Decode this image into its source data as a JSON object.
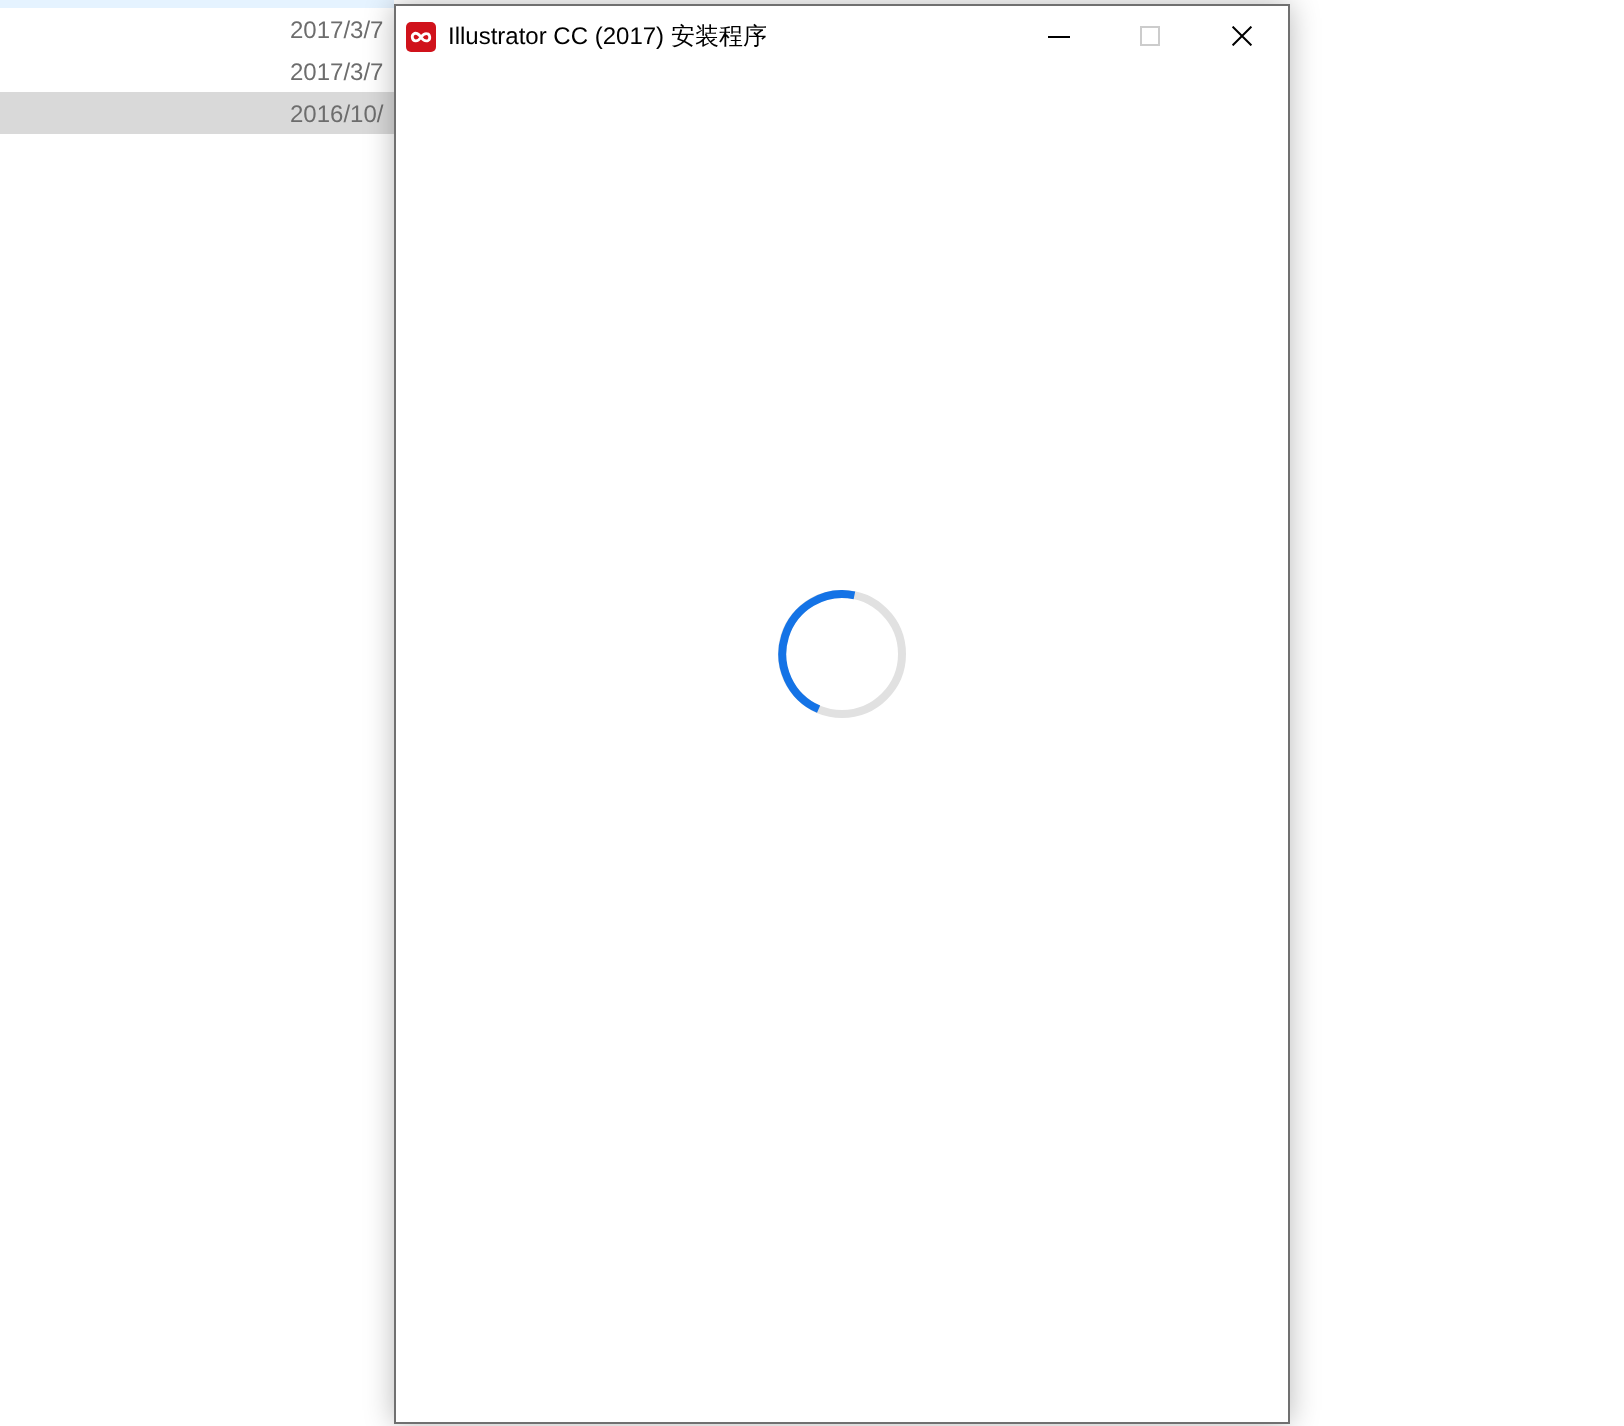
{
  "background_list": {
    "rows": [
      {
        "hovered": true,
        "selected": false
      },
      {
        "date": "2017/3/7",
        "hovered": false,
        "selected": false
      },
      {
        "date": "2017/3/7",
        "hovered": false,
        "selected": false
      },
      {
        "date": "2016/10/",
        "hovered": false,
        "selected": true
      }
    ]
  },
  "window": {
    "title": "Illustrator CC (2017) 安装程序",
    "controls": [
      {
        "kind": "minimize",
        "disabled": false
      },
      {
        "kind": "maximize",
        "disabled": true
      },
      {
        "kind": "close",
        "disabled": false
      }
    ]
  }
}
